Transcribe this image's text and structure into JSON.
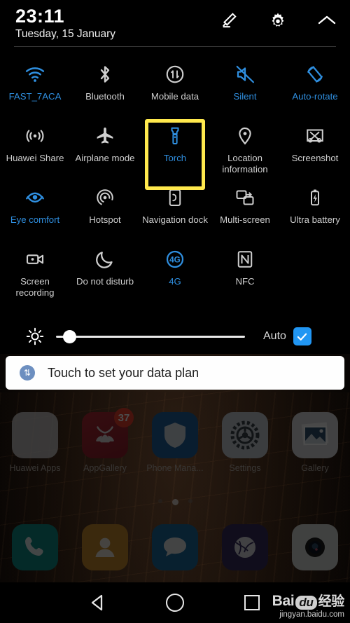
{
  "statusbar": {
    "time": "23:11",
    "date": "Tuesday, 15 January",
    "edit_icon": "pencil-icon",
    "settings_icon": "gear-icon",
    "collapse_icon": "chevron-up-icon"
  },
  "colors": {
    "active": "#2f8fe0",
    "inactive": "#cfcfcf",
    "highlight": "#ffe94d",
    "checkbox": "#2196f3",
    "badge": "#e8402a",
    "panel_bg": "#000000",
    "card_bg": "#ffffff"
  },
  "quick_settings": {
    "rows": [
      [
        {
          "label": "FAST_7ACA",
          "icon": "wifi-icon",
          "active": true
        },
        {
          "label": "Bluetooth",
          "icon": "bluetooth-icon",
          "active": false
        },
        {
          "label": "Mobile data",
          "icon": "mobile-data-icon",
          "active": false
        },
        {
          "label": "Silent",
          "icon": "mute-icon",
          "active": true
        },
        {
          "label": "Auto-rotate",
          "icon": "auto-rotate-icon",
          "active": true
        }
      ],
      [
        {
          "label": "Huawei Share",
          "icon": "huawei-share-icon",
          "active": false
        },
        {
          "label": "Airplane mode",
          "icon": "airplane-icon",
          "active": false
        },
        {
          "label": "Torch",
          "icon": "torch-icon",
          "active": true,
          "highlighted": true
        },
        {
          "label": "Location information",
          "icon": "location-pin-icon",
          "active": false
        },
        {
          "label": "Screenshot",
          "icon": "screenshot-icon",
          "active": false
        }
      ],
      [
        {
          "label": "Eye comfort",
          "icon": "eye-icon",
          "active": true
        },
        {
          "label": "Hotspot",
          "icon": "hotspot-icon",
          "active": false
        },
        {
          "label": "Navigation dock",
          "icon": "navigation-dock-icon",
          "active": false
        },
        {
          "label": "Multi-screen",
          "icon": "multi-screen-icon",
          "active": false
        },
        {
          "label": "Ultra battery",
          "icon": "battery-bolt-icon",
          "active": false
        }
      ],
      [
        {
          "label": "Screen recording",
          "icon": "video-camera-icon",
          "active": false
        },
        {
          "label": "Do not disturb",
          "icon": "moon-icon",
          "active": false
        },
        {
          "label": "4G",
          "icon": "network-4g-icon",
          "active": true
        },
        {
          "label": "NFC",
          "icon": "nfc-icon",
          "active": false
        },
        {
          "label": "",
          "icon": "",
          "active": false
        }
      ]
    ]
  },
  "brightness": {
    "icon": "brightness-sun-icon",
    "value_percent": 4,
    "auto_label": "Auto",
    "auto_checked": true,
    "check_glyph": "✓"
  },
  "notification": {
    "icon": "data-plan-icon",
    "icon_glyph": "⇅",
    "text": "Touch to set your data plan"
  },
  "home_screen": {
    "apps_row": [
      {
        "label": "Huawei Apps",
        "icon": "folder-icon"
      },
      {
        "label": "AppGallery",
        "icon": "appgallery-icon",
        "badge": "37"
      },
      {
        "label": "Phone Mana...",
        "icon": "phone-manager-shield-icon"
      },
      {
        "label": "Settings",
        "icon": "gear-icon"
      },
      {
        "label": "Gallery",
        "icon": "gallery-photo-icon"
      }
    ],
    "dock_row": [
      {
        "label": "",
        "icon": "phone-icon"
      },
      {
        "label": "",
        "icon": "contacts-icon"
      },
      {
        "label": "",
        "icon": "messages-icon"
      },
      {
        "label": "",
        "icon": "browser-icon"
      },
      {
        "label": "",
        "icon": "camera-icon"
      }
    ],
    "page_indicator": {
      "pages": 3,
      "active": 2
    }
  },
  "navbar": {
    "back": "back-triangle-icon",
    "home": "home-circle-icon",
    "recents": "recents-square-icon"
  },
  "watermark": {
    "brand": "Bai",
    "du": "du",
    "suffix": "经验",
    "url": "jingyan.baidu.com"
  }
}
